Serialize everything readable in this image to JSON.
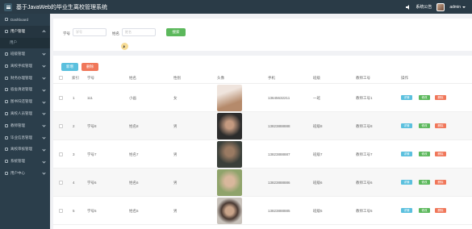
{
  "app": {
    "title": "基于JavaWeb的毕业生离校管理系统",
    "notice_label": "系统公告",
    "user_label": "admin"
  },
  "sidebar": {
    "items": [
      {
        "label": "Dashboard",
        "active": false
      },
      {
        "label": "用户管理",
        "active": true
      },
      {
        "label": "班级管理",
        "active": false
      },
      {
        "label": "离校手续管理",
        "active": false
      },
      {
        "label": "财务办理管理",
        "active": false
      },
      {
        "label": "宿舍清退管理",
        "active": false
      },
      {
        "label": "图书归还管理",
        "active": false
      },
      {
        "label": "离校人员管理",
        "active": false
      },
      {
        "label": "教师管理",
        "active": false
      },
      {
        "label": "毕业信息管理",
        "active": false
      },
      {
        "label": "离校审核管理",
        "active": false
      },
      {
        "label": "系统管理",
        "active": false
      },
      {
        "label": "用户中心",
        "active": false
      }
    ],
    "sub_item": "用户"
  },
  "search": {
    "student_no_label": "学号",
    "student_no_placeholder": "学号",
    "name_label": "姓名",
    "name_placeholder": "姓名",
    "button": "搜索"
  },
  "actions": {
    "add": "新增",
    "delete": "删除"
  },
  "table": {
    "columns": [
      "索引",
      "学号",
      "姓名",
      "性别",
      "头像",
      "手机",
      "班级",
      "教师工号",
      "操作"
    ],
    "row_buttons": {
      "view": "详情",
      "edit": "修改",
      "delete": "删除"
    },
    "rows": [
      {
        "index": "1",
        "student_no": "111",
        "name": "小画",
        "gender": "女",
        "phone": "13645632211",
        "class": "一班",
        "teacher_no": "教师工号1",
        "photo_colors": [
          "#e9d7cf",
          "#b58a6b"
        ]
      },
      {
        "index": "2",
        "student_no": "学号8",
        "name": "姓名8",
        "gender": "男",
        "phone": "13823888888",
        "class": "班级8",
        "teacher_no": "教师工号8",
        "photo_colors": [
          "#2c2c2c",
          "#8e6b5a"
        ]
      },
      {
        "index": "3",
        "student_no": "学号7",
        "name": "姓名7",
        "gender": "男",
        "phone": "13823888887",
        "class": "班级7",
        "teacher_no": "教师工号7",
        "photo_colors": [
          "#3a3f3a",
          "#9a7a62"
        ]
      },
      {
        "index": "4",
        "student_no": "学号6",
        "name": "姓名6",
        "gender": "男",
        "phone": "13823888886",
        "class": "班级6",
        "teacher_no": "教师工号6",
        "photo_colors": [
          "#8fa36b",
          "#d8b79c"
        ]
      },
      {
        "index": "5",
        "student_no": "学号5",
        "name": "姓名5",
        "gender": "男",
        "phone": "13823888885",
        "class": "班级5",
        "teacher_no": "教师工号5",
        "photo_colors": [
          "#c9c3bc",
          "#4a3a33"
        ]
      }
    ]
  },
  "colors": {
    "topbar": "#2a3b47",
    "sidebar": "#2b3e4b",
    "primary_blue": "#5bc0de",
    "success_green": "#5cb85c",
    "danger_red": "#f0775a"
  }
}
